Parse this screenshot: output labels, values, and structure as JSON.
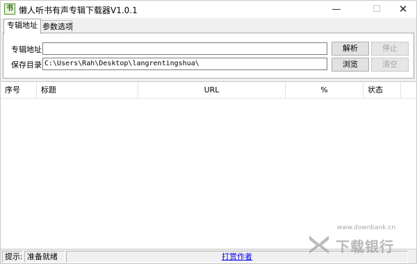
{
  "window": {
    "title": "懒人听书有声专辑下载器V1.0.1",
    "icon_name": "app-book-icon",
    "controls": {
      "minimize": "—",
      "maximize": "☐",
      "close": "✕"
    }
  },
  "tabs": [
    {
      "label": "专辑地址",
      "active": true
    },
    {
      "label": "参数选项",
      "active": false
    }
  ],
  "form": {
    "url_label": "专辑地址:",
    "url_value": "",
    "save_label": "保存目录:",
    "save_value": "C:\\Users\\Rah\\Desktop\\langrentingshua\\",
    "parse_button": "解析",
    "stop_button": "停止",
    "browse_button": "浏览",
    "clear_button": "清空"
  },
  "table": {
    "columns": [
      "序号",
      "标题",
      "URL",
      "%",
      "状态"
    ],
    "rows": []
  },
  "status": {
    "hint_label": "提示:",
    "hint_value": "准备就绪",
    "author_link": "打赏作者"
  },
  "watermark": {
    "text": "下载银行",
    "url": "www.downbank.cn"
  },
  "colors": {
    "window_bg": "#f0f0f0",
    "link": "#0000ee",
    "disabled_text": "#a6a6a6",
    "logo_green": "#2c6a12"
  }
}
